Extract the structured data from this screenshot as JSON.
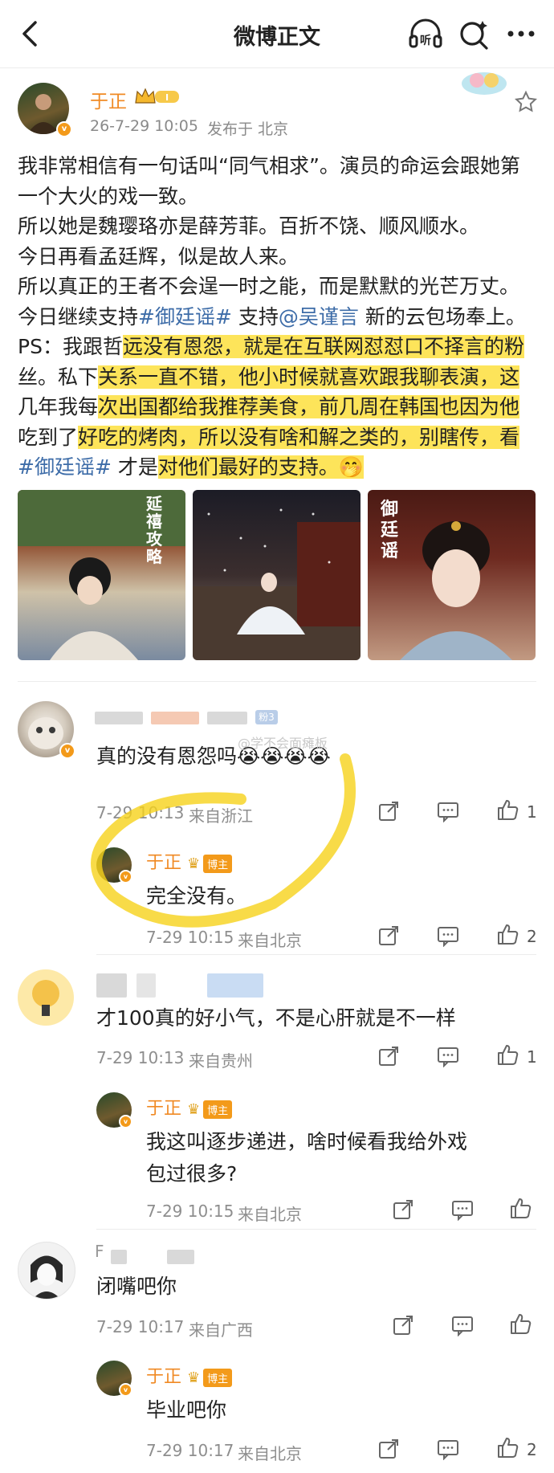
{
  "header": {
    "title": "微博正文"
  },
  "post": {
    "author": "于正",
    "time": "26-7-29 10:05",
    "location": "发布于 北京",
    "lines": [
      "我非常相信有一句话叫“同气相求”。演员的命运会跟她第",
      "一个大火的戏一致。",
      "所以她是魏璎珞亦是薛芳菲。百折不饶、顺风顺水。",
      "今日再看孟廷辉，似是故人来。",
      "所以真正的王者不会逞一时之能，而是默默的光芒万丈。"
    ],
    "line6_a": "今日继续支持",
    "line6_tag": "#御廷谣#",
    "line6_b": " 支持",
    "line6_mention": "@吴谨言",
    "line6_c": " 新的云包场奉上。",
    "line7_a": "PS：我跟哲",
    "line7_b": "远没有恩怨，就是在互联网怼怼口不择言的粉",
    "line8_a": "丝。私下",
    "line8_b": "关系一直不错，他小时候就喜欢跟我聊表演，这",
    "line9_a": "几年我每",
    "line9_b": "次出国都给我推荐美食，前几周在韩国也因为他",
    "line10_a": "吃到了",
    "line10_b": "好吃的烤肉，所以没有啥和解之类的，别瞎传，看",
    "line11_tag": "#御廷谣#",
    "line11_a": " 才是",
    "line11_b": "对他们最好的支持。",
    "emoji": "🤭",
    "photo1_text": "延禧攻略",
    "photo3_text": "御廷谣"
  },
  "comments": [
    {
      "text": "真的没有恩怨吗😭😭😭😭",
      "time": "7-29 10:13",
      "from": "来自浙江",
      "likes": "1",
      "extra": "粉3",
      "watermark": "@学不会面瘫板",
      "reply": {
        "name": "于正",
        "badge": "博主",
        "text": "完全没有。",
        "time": "7-29 10:15",
        "from": "来自北京",
        "likes": "2"
      }
    },
    {
      "text": "才100真的好小气，不是心肝就是不一样",
      "time": "7-29 10:13",
      "from": "来自贵州",
      "likes": "1",
      "reply": {
        "name": "于正",
        "badge": "博主",
        "text1": "我这叫逐步递进，啥时候看我给外戏",
        "text2": "包过很多?",
        "time": "7-29 10:15",
        "from": "来自北京",
        "likes": ""
      }
    },
    {
      "name_prefix": "F",
      "text": "闭嘴吧你",
      "time": "7-29 10:17",
      "from": "来自广西",
      "likes": "",
      "reply": {
        "name": "于正",
        "badge": "博主",
        "text": "毕业吧你",
        "time": "7-29 10:17",
        "from": "来自北京",
        "likes": "2"
      }
    }
  ],
  "colors": {
    "accent": "#f08a24",
    "link": "#3d6ca8",
    "highlight": "#fde45a"
  }
}
